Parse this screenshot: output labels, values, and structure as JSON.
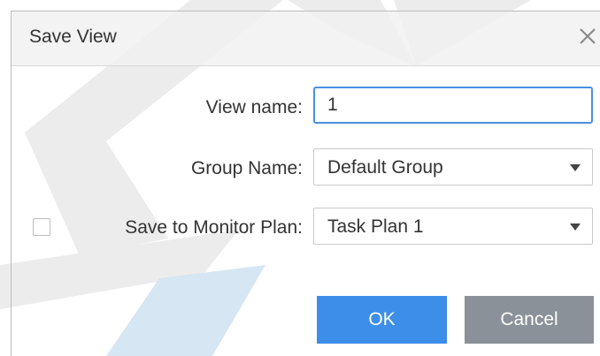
{
  "dialog": {
    "title": "Save View",
    "close_icon": "close-icon"
  },
  "form": {
    "view_name": {
      "label": "View name:",
      "value": "1"
    },
    "group_name": {
      "label": "Group Name:",
      "selected": "Default Group"
    },
    "monitor_plan": {
      "checkbox_checked": false,
      "label": "Save to Monitor Plan:",
      "selected": "Task Plan 1"
    }
  },
  "buttons": {
    "ok_label": "OK",
    "cancel_label": "Cancel"
  },
  "colors": {
    "primary": "#3d8ee8",
    "secondary": "#8a9199",
    "focus_border": "#4a90e2",
    "watermark_gray": "#ececec",
    "watermark_blue": "#d6e6f2"
  }
}
